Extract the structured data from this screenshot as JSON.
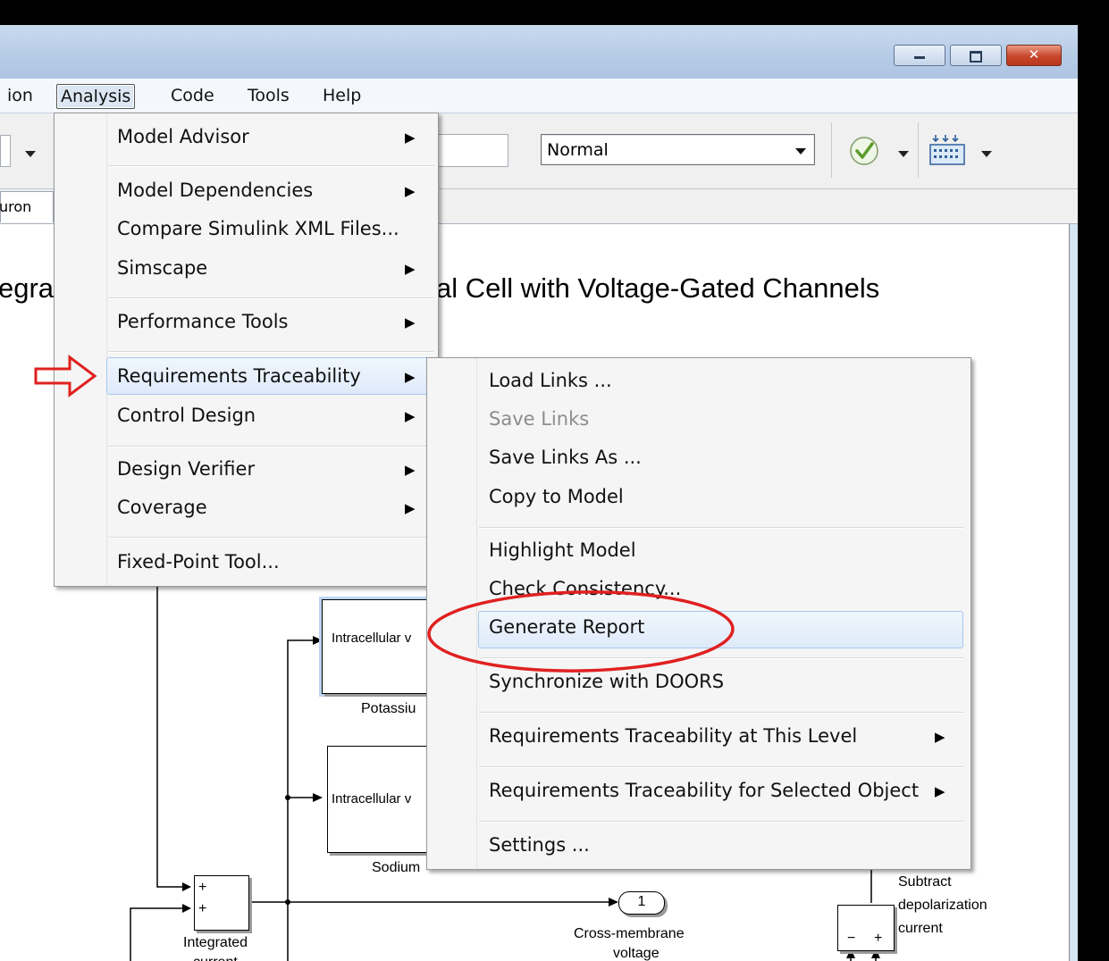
{
  "menubar": {
    "partial_left": "ion",
    "items": [
      "Analysis",
      "Code",
      "Tools",
      "Help"
    ]
  },
  "toolbar": {
    "sim_mode_value": "Normal"
  },
  "tab": {
    "partial_label": "uron"
  },
  "canvas": {
    "heading_left": "egra",
    "heading_right": "al Cell with Voltage-Gated Channels",
    "block_partial_1": "Intracellular v",
    "block_label_1": "Potassiu",
    "block_partial_2": "Intracellular v",
    "block_label_2": "Sodium",
    "sum_label_line1": "Integrated",
    "sum_label_line2": "current",
    "sum_signs": [
      "+",
      "+"
    ],
    "outport_number": "1",
    "outport_label_line1": "Cross-membrane",
    "outport_label_line2": "voltage",
    "subtract_label_line1": "Subtract",
    "subtract_label_line2": "depolarization",
    "subtract_label_line3": "current",
    "subtract_signs": [
      "−",
      "+"
    ]
  },
  "analysis_menu": {
    "items": [
      "Model Advisor",
      "Model Dependencies",
      "Compare Simulink XML Files...",
      "Simscape",
      "Performance Tools",
      "Requirements Traceability",
      "Control Design",
      "Design Verifier",
      "Coverage",
      "Fixed-Point Tool..."
    ]
  },
  "req_submenu": {
    "items": [
      "Load Links ...",
      "Save Links",
      "Save Links As ...",
      "Copy to Model",
      "Highlight Model",
      "Check Consistency...",
      "Generate Report",
      "Synchronize with DOORS",
      "Requirements Traceability at This Level",
      "Requirements Traceability for Selected Object",
      "Settings ..."
    ]
  },
  "colors": {
    "annotation_red": "#e02020",
    "menu_highlight": "#dfeafa",
    "menu_bg": "#f5f5f5",
    "check_green": "#5a9a2a"
  },
  "icons": [
    "minimize-icon",
    "maximize-icon",
    "close-icon",
    "dropdown-arrow-icon",
    "check-icon",
    "library-browser-icon",
    "submenu-arrow-icon",
    "red-arrow-annotation"
  ]
}
